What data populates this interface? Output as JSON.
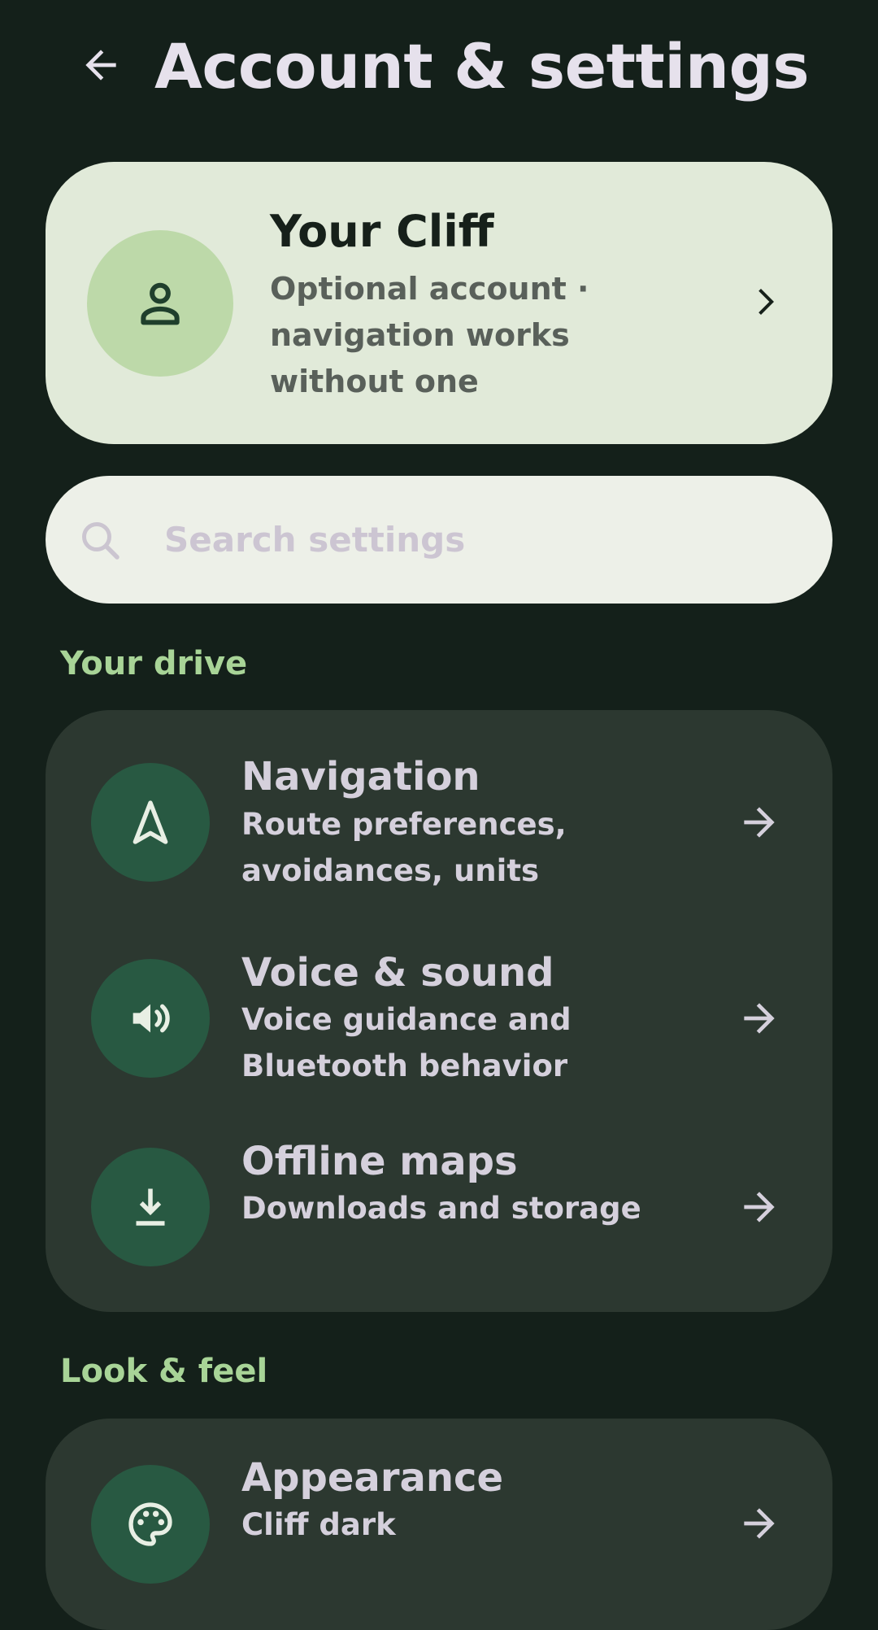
{
  "header": {
    "title": "Account & settings",
    "back_icon": "arrow-back-icon"
  },
  "account": {
    "name": "Your Cliff",
    "subtitle": "Optional account · navigation works without one",
    "avatar_icon": "person-icon",
    "chevron_icon": "chevron-right-icon"
  },
  "search": {
    "placeholder": "Search settings",
    "value": "",
    "icon": "search-icon"
  },
  "sections": [
    {
      "label": "Your drive",
      "items": [
        {
          "title": "Navigation",
          "subtitle": "Route preferences, avoidances, units",
          "icon": "navigation-arrow-icon"
        },
        {
          "title": "Voice & sound",
          "subtitle": "Voice guidance and Bluetooth behavior",
          "icon": "speaker-icon"
        },
        {
          "title": "Offline maps",
          "subtitle": "Downloads and storage",
          "icon": "download-icon"
        }
      ]
    },
    {
      "label": "Look & feel",
      "items": [
        {
          "title": "Appearance",
          "subtitle": "Cliff dark",
          "icon": "palette-icon"
        }
      ]
    }
  ],
  "colors": {
    "background": "#14201a",
    "account_card": "#e1ead9",
    "avatar_bg": "#bdd9a9",
    "search_bg": "#edf0e8",
    "section_label": "#a8d497",
    "group_bg": "#2c3830",
    "row_icon_bg": "#285942",
    "text_light": "#d5d0dc"
  }
}
